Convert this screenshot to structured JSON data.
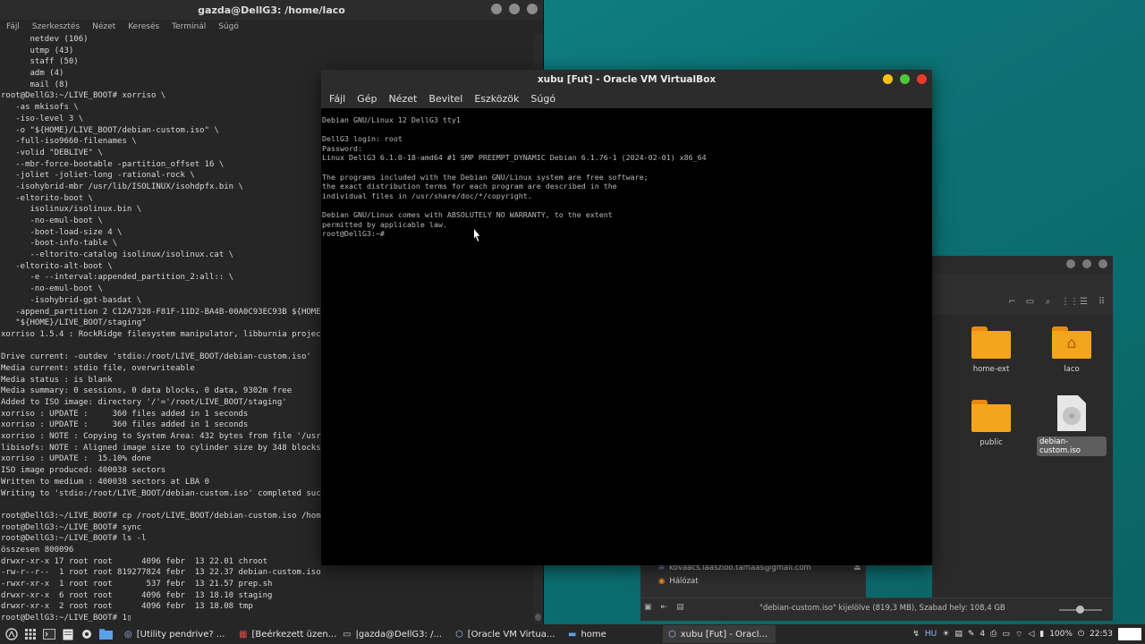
{
  "terminal": {
    "title": "gazda@DellG3: /home/laco",
    "menu": [
      "Fájl",
      "Szerkesztés",
      "Nézet",
      "Keresés",
      "Terminál",
      "Súgó"
    ],
    "lines": [
      "      netdev (106)",
      "      utmp (43)",
      "      staff (50)",
      "      adm (4)",
      "      mail (8)",
      "root@DellG3:~/LIVE_BOOT# xorriso \\",
      "   -as mkisofs \\",
      "   -iso-level 3 \\",
      "   -o \"${HOME}/LIVE_BOOT/debian-custom.iso\" \\",
      "   -full-iso9660-filenames \\",
      "   -volid \"DEBLIVE\" \\",
      "   --mbr-force-bootable -partition_offset 16 \\",
      "   -joliet -joliet-long -rational-rock \\",
      "   -isohybrid-mbr /usr/lib/ISOLINUX/isohdpfx.bin \\",
      "   -eltorito-boot \\",
      "      isolinux/isolinux.bin \\",
      "      -no-emul-boot \\",
      "      -boot-load-size 4 \\",
      "      -boot-info-table \\",
      "      --eltorito-catalog isolinux/isolinux.cat \\",
      "   -eltorito-alt-boot \\",
      "      -e --interval:appended_partition_2:all:: \\",
      "      -no-emul-boot \\",
      "      -isohybrid-gpt-basdat \\",
      "   -append_partition 2 C12A7328-F81F-11D2-BA4B-00A0C93EC93B ${HOME",
      "   \"${HOME}/LIVE_BOOT/staging\"",
      "xorriso 1.5.4 : RockRidge filesystem manipulator, libburnia project",
      "",
      "Drive current: -outdev 'stdio:/root/LIVE_BOOT/debian-custom.iso'",
      "Media current: stdio file, overwriteable",
      "Media status : is blank",
      "Media summary: 0 sessions, 0 data blocks, 0 data, 9302m free",
      "Added to ISO image: directory '/'='/root/LIVE_BOOT/staging'",
      "xorriso : UPDATE :     360 files added in 1 seconds",
      "xorriso : UPDATE :     360 files added in 1 seconds",
      "xorriso : NOTE : Copying to System Area: 432 bytes from file '/usr/",
      "libisofs: NOTE : Aligned image size to cylinder size by 348 blocks",
      "xorriso : UPDATE :  15.10% done",
      "ISO image produced: 400038 sectors",
      "Written to medium : 400038 sectors at LBA 0",
      "Writing to 'stdio:/root/LIVE_BOOT/debian-custom.iso' completed succ",
      "",
      "root@DellG3:~/LIVE_BOOT# cp /root/LIVE_BOOT/debian-custom.iso /home",
      "root@DellG3:~/LIVE_BOOT# sync",
      "root@DellG3:~/LIVE_BOOT# ls -l",
      "összesen 800096",
      "drwxr-xr-x 17 root root      4096 febr  13 22.01 chroot",
      "-rw-r--r--  1 root root 819277824 febr  13 22.37 debian-custom.iso",
      "-rwxr-xr-x  1 root root       537 febr  13 21.57 prep.sh",
      "drwxr-xr-x  6 root root      4096 febr  13 18.10 staging",
      "drwxr-xr-x  2 root root      4096 febr  13 18.08 tmp",
      "root@DellG3:~/LIVE_BOOT# 1▯"
    ]
  },
  "vbox": {
    "title": "xubu [Fut] - Oracle VM VirtualBox",
    "menu": [
      "Fájl",
      "Gép",
      "Nézet",
      "Bevitel",
      "Eszközök",
      "Súgó"
    ],
    "console": [
      "Debian GNU/Linux 12 DellG3 tty1",
      "",
      "DellG3 login: root",
      "Password:",
      "Linux DellG3 6.1.0-18-amd64 #1 SMP PREEMPT_DYNAMIC Debian 6.1.76-1 (2024-02-01) x86_64",
      "",
      "The programs included with the Debian GNU/Linux system are free software;",
      "the exact distribution terms for each program are described in the",
      "individual files in /usr/share/doc/*/copyright.",
      "",
      "Debian GNU/Linux comes with ABSOLUTELY NO WARRANTY, to the extent",
      "permitted by applicable law.",
      "root@DellG3:~# "
    ]
  },
  "filemanager": {
    "items": [
      {
        "label": "home-ext",
        "icon": "folder-icon"
      },
      {
        "label": "laco",
        "icon": "home-folder-icon"
      },
      {
        "label": "public",
        "icon": "folder-icon"
      },
      {
        "label": "debian-custom.iso",
        "icon": "disc-image-icon"
      }
    ],
    "sidebar": {
      "account": "kovaacs.laaszloo.tamaas@gmail.com",
      "network": "Hálózat"
    },
    "status": "\"debian-custom.iso\" kijelölve (819,3 MB), Szabad hely: 108,4 GB"
  },
  "taskbar": {
    "tasks": [
      {
        "label": "[Utility pendrive? ...",
        "icon": "chromium-icon",
        "active": false
      },
      {
        "label": "[Beérkezett üzen...",
        "icon": "mail-icon",
        "active": false
      },
      {
        "label": "|gazda@DellG3: /...",
        "icon": "terminal-icon",
        "active": false
      },
      {
        "label": "[Oracle VM Virtua...",
        "icon": "virtualbox-icon",
        "active": false
      },
      {
        "label": "home",
        "icon": "folder-icon",
        "active": false
      },
      {
        "label": "xubu [Fut] - Oracl...",
        "icon": "virtualbox-icon",
        "active": true
      }
    ],
    "keyboard_layout": "HU",
    "notif_count": "4",
    "battery": "100%",
    "clock": "22:53"
  }
}
